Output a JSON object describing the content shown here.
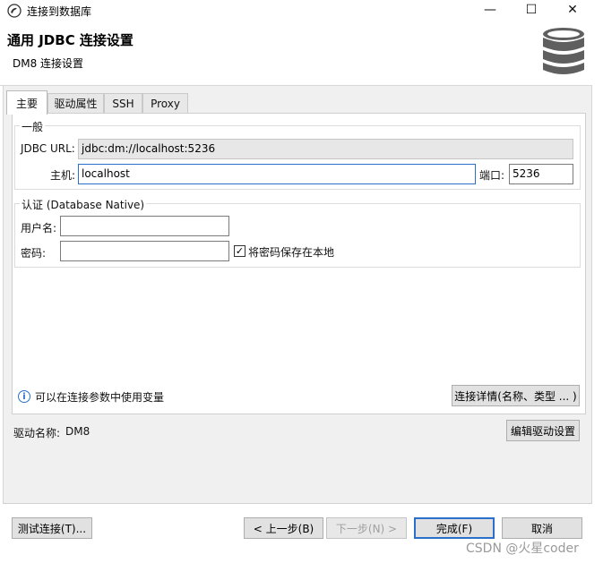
{
  "window": {
    "title": "连接到数据库",
    "minimize": "—",
    "maximize": "☐",
    "close": "✕"
  },
  "header": {
    "title": "通用 JDBC 连接设置",
    "subtitle": "DM8 连接设置"
  },
  "tabs": [
    {
      "label": "主要",
      "active": true
    },
    {
      "label": "驱动属性",
      "active": false
    },
    {
      "label": "SSH",
      "active": false
    },
    {
      "label": "Proxy",
      "active": false
    }
  ],
  "general": {
    "group_label": "一般",
    "jdbc_url_label": "JDBC URL:",
    "jdbc_url_value": "jdbc:dm://localhost:5236",
    "host_label": "主机:",
    "host_value": "localhost",
    "port_label": "端口:",
    "port_value": "5236"
  },
  "auth": {
    "group_label": "认证 (Database Native)",
    "username_label": "用户名:",
    "username_value": "",
    "password_label": "密码:",
    "password_value": "",
    "save_password_label": "将密码保存在本地",
    "save_password_checked": true
  },
  "info": {
    "text": "可以在连接参数中使用变量",
    "details_button": "连接详情(名称、类型 ... )"
  },
  "driver": {
    "label": "驱动名称:",
    "value": "DM8",
    "edit_button": "编辑驱动设置"
  },
  "footer": {
    "test_button": "测试连接(T)...",
    "back_button": "< 上一步(B)",
    "next_button": "下一步(N) >",
    "finish_button": "完成(F)",
    "cancel_button": "取消"
  },
  "watermark": "CSDN @火星coder",
  "colors": {
    "accent": "#2a6fc9",
    "panel": "#f0f0f0",
    "db_icon": "#5f5f5f"
  }
}
